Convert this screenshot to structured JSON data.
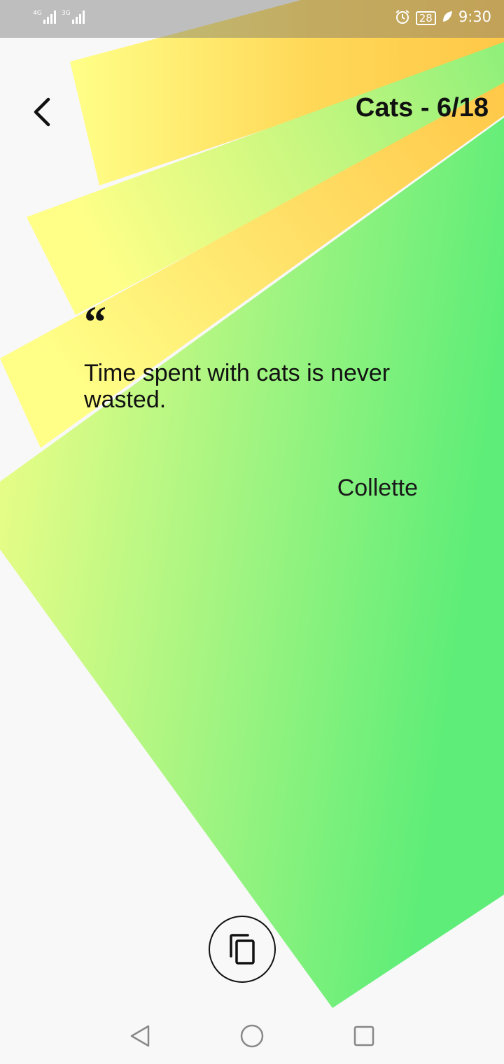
{
  "status_bar": {
    "network_1": "4G",
    "network_2": "3G",
    "battery_level": "28",
    "time": "9:30",
    "icons": [
      "signal-icon",
      "signal-icon",
      "alarm-icon",
      "battery-icon",
      "leaf-icon"
    ]
  },
  "header": {
    "back_icon": "chevron-left-icon",
    "title": "Cats - 6/18"
  },
  "quote": {
    "mark": "“",
    "text": "Time spent with cats is never wasted.",
    "author": "Collette"
  },
  "actions": {
    "copy_icon": "copy-icon"
  },
  "nav_bar": {
    "icons": [
      "back-triangle-icon",
      "home-circle-icon",
      "recents-square-icon"
    ]
  },
  "colors": {
    "background": "#f8f8f8",
    "card_yellow": "#ffff88",
    "card_orange": "#ffc848",
    "card_green": "#5ded78",
    "text": "#111111"
  }
}
